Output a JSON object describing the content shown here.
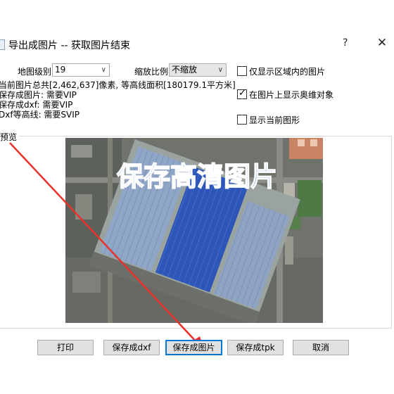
{
  "window": {
    "title": "导出成图片 -- 获取图片结束",
    "help": "?",
    "close": "✕"
  },
  "level": {
    "label": "地图级别",
    "value": "19"
  },
  "scale": {
    "label": "缩放比例",
    "value": "不缩放"
  },
  "info_lines": [
    "当前图片总共[2,462,637]像素, 等高线面积[180179.1平方米]",
    "保存成图片: 需要VIP",
    "保存成dxf: 需要VIP",
    "Dxf等高线: 需要SVIP"
  ],
  "checkboxes": [
    {
      "label": "仅显示区域内的图片",
      "checked": false
    },
    {
      "label": "在图片上显示奥维对象",
      "checked": true
    },
    {
      "label": "显示当前图形",
      "checked": false
    }
  ],
  "preview": {
    "legend": "预览",
    "watermark": "保存高清图片"
  },
  "buttons": {
    "print": "打印",
    "save_dxf": "保存成dxf",
    "save_image": "保存成图片",
    "save_tpk": "保存成tpk",
    "cancel": "取消"
  },
  "colors": {
    "accent": "#0078d7",
    "annotation_arrow": "#e8322b",
    "watermark": "#3a73d8"
  }
}
